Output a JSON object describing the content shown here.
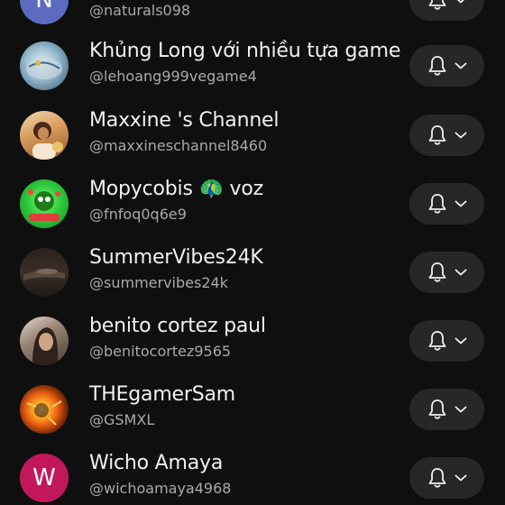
{
  "subscriptions": [
    {
      "name": "",
      "handle": "@naturals098",
      "avatar": {
        "type": "letter",
        "letter": "N",
        "color": "#5c6bc0"
      }
    },
    {
      "name": "Khủng Long với nhiều tựa game",
      "handle": "@lehoang999vegame4",
      "avatar": {
        "type": "image",
        "color": "#7fa3b8"
      }
    },
    {
      "name": "Maxxine 's Channel",
      "handle": "@maxxineschannel8460",
      "avatar": {
        "type": "image",
        "color": "#d89a5a"
      }
    },
    {
      "name": "Mopycobis 🦚 voz",
      "handle": "@fnfoq0q6e9",
      "avatar": {
        "type": "image",
        "color": "#2ecc40"
      }
    },
    {
      "name": "SummerVibes24K",
      "handle": "@summervibes24k",
      "avatar": {
        "type": "image",
        "color": "#3a2f28"
      }
    },
    {
      "name": "benito cortez paul",
      "handle": "@benitocortez9565",
      "avatar": {
        "type": "image",
        "color": "#6b5a4e"
      }
    },
    {
      "name": "THEgamerSam",
      "handle": "@GSMXL",
      "avatar": {
        "type": "image",
        "color": "#e85d10"
      }
    },
    {
      "name": "Wicho Amaya",
      "handle": "@wichoamaya4968",
      "avatar": {
        "type": "letter",
        "letter": "W",
        "color": "#c2185b"
      }
    }
  ],
  "icons": {
    "notification": "bell-icon",
    "dropdown": "chevron-down-icon"
  },
  "colors": {
    "background": "#0f0f0f",
    "button": "#272727",
    "primary_text": "#f1f1f1",
    "secondary_text": "#aaaaaa"
  }
}
